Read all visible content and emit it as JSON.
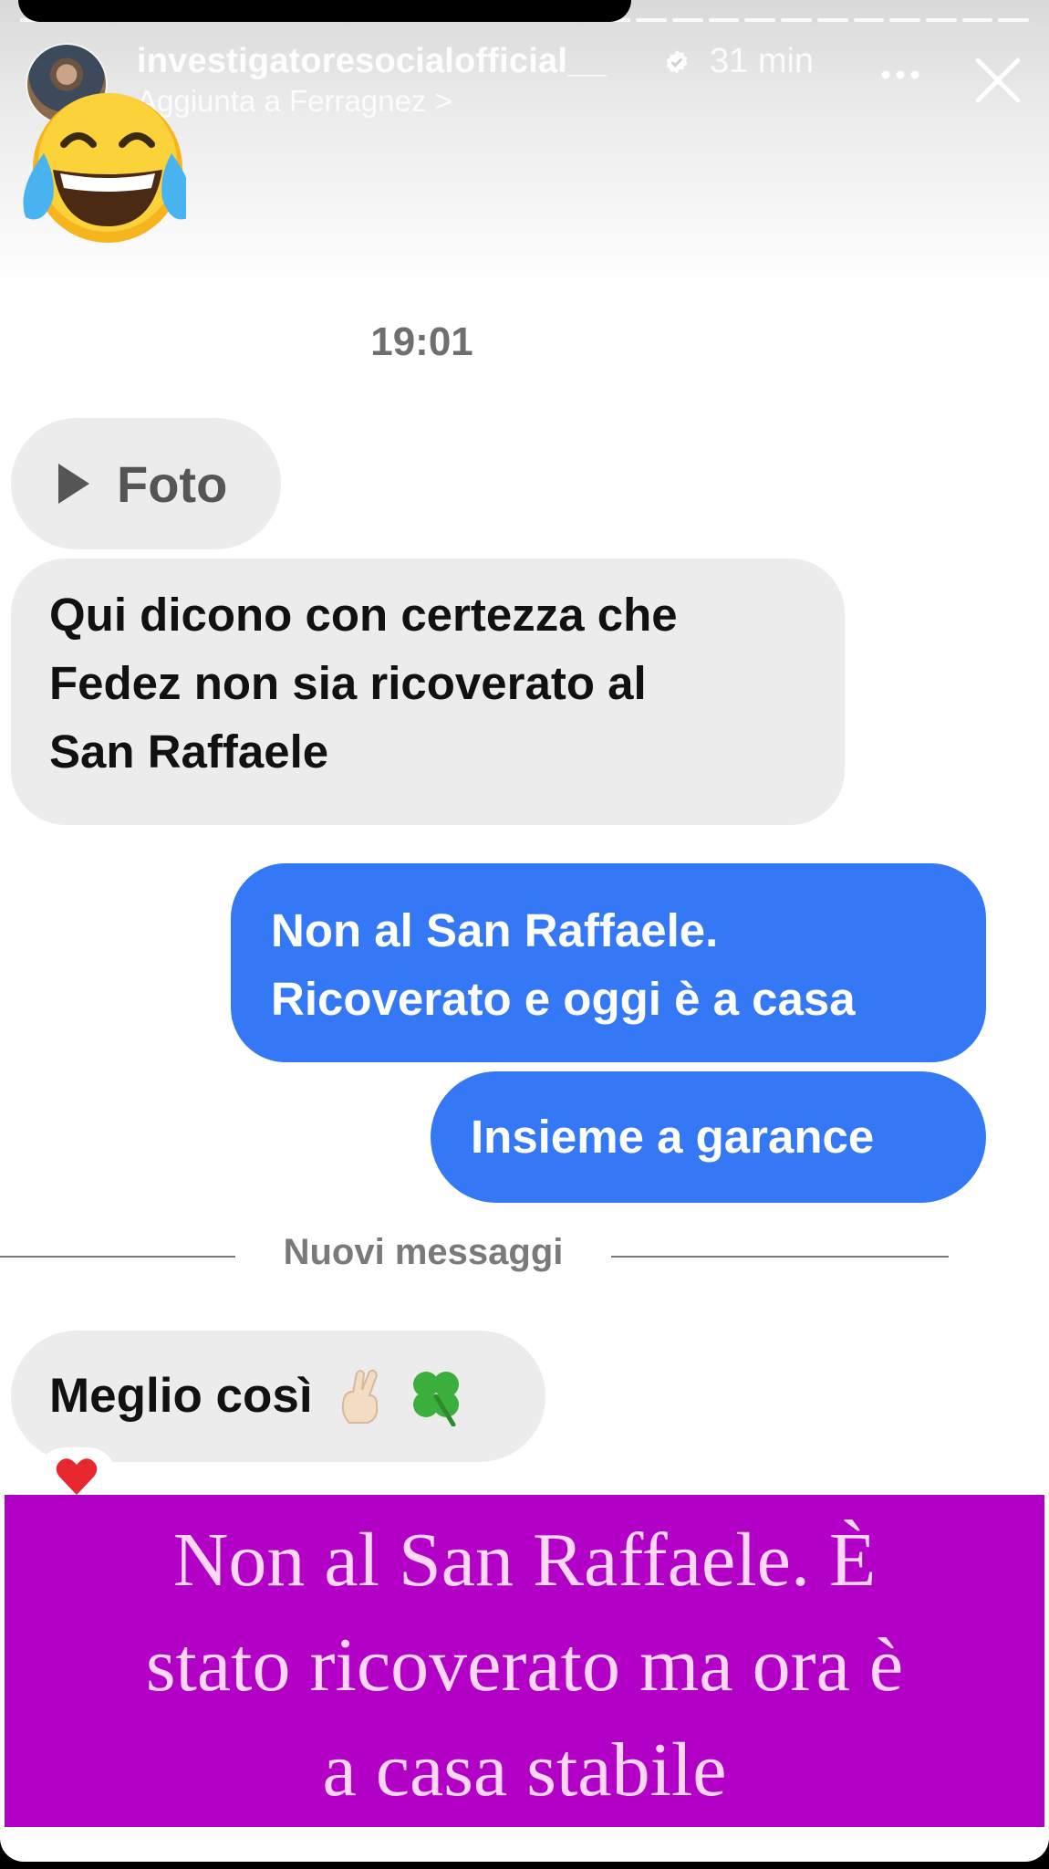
{
  "header": {
    "username": "investigatoresocialofficial__",
    "time_ago": "31 min",
    "subtitle": "Aggiunta a Ferragnez >"
  },
  "chat": {
    "timestamp": "19:01",
    "photo_label": "Foto",
    "incoming_1_lines": [
      "Qui dicono con certezza che",
      "Fedez non sia ricoverato al",
      "San Raffaele"
    ],
    "outgoing_1_lines": [
      "Non al San Raffaele.",
      "Ricoverato e oggi è a casa"
    ],
    "outgoing_2": "Insieme a garance",
    "divider_label": "Nuovi messaggi",
    "incoming_2": "Meglio così"
  },
  "banner": {
    "lines": [
      "Non al San Raffaele. È",
      "stato ricoverato ma ora è",
      "a casa stabile"
    ]
  },
  "colors": {
    "outgoing_bubble": "#3478f6",
    "incoming_bubble": "#ececec",
    "banner_background": "#b200c6",
    "banner_text": "#ffd6f3"
  },
  "icons": [
    "verified-badge-icon",
    "more-icon",
    "close-icon",
    "laughing-emoji-icon",
    "play-icon",
    "crossed-fingers-emoji-icon",
    "four-leaf-clover-emoji-icon",
    "heart-reaction-icon"
  ]
}
